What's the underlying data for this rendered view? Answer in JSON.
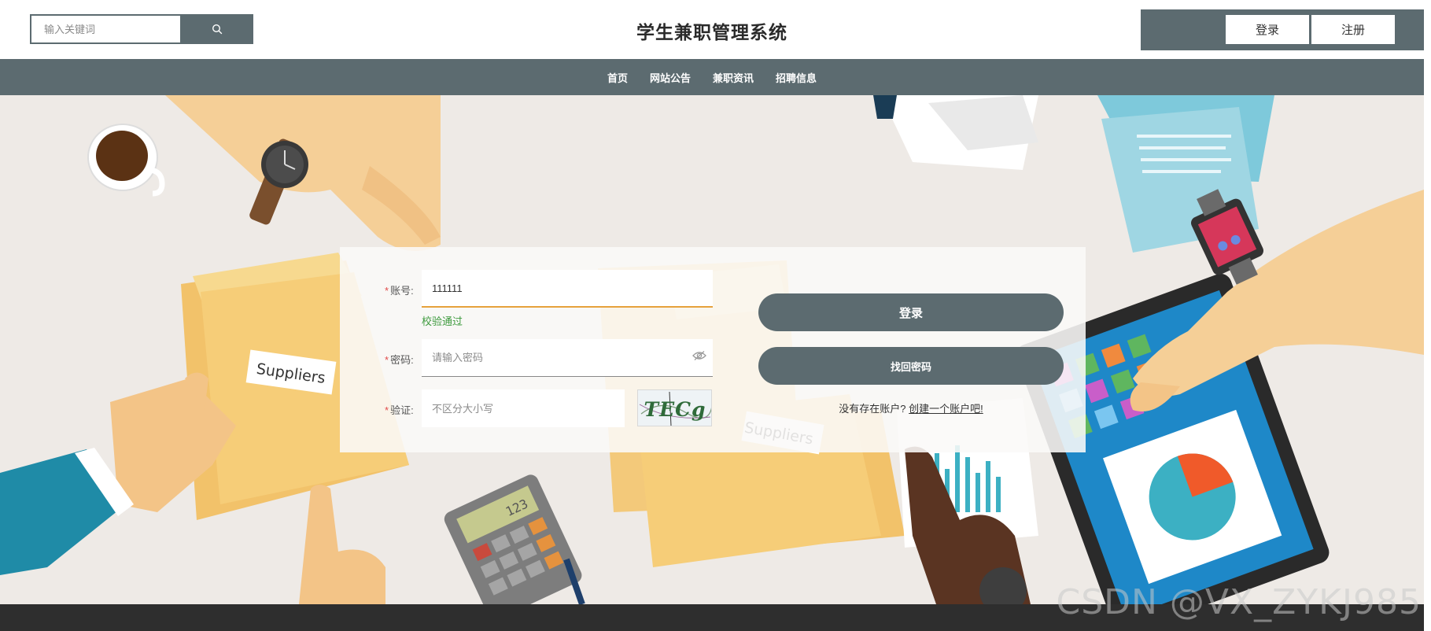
{
  "header": {
    "search_placeholder": "输入关键词",
    "site_title": "学生兼职管理系统",
    "login_label": "登录",
    "register_label": "注册"
  },
  "nav": {
    "items": [
      {
        "label": "首页"
      },
      {
        "label": "网站公告"
      },
      {
        "label": "兼职资讯"
      },
      {
        "label": "招聘信息"
      }
    ]
  },
  "hero": {
    "folder_label": "Suppliers",
    "calculator_display": "123"
  },
  "login_form": {
    "required_mark": "*",
    "account_label": "账号:",
    "account_value": "111111",
    "validation_message": "校验通过",
    "password_label": "密码:",
    "password_placeholder": "请输入密码",
    "captcha_label": "验证:",
    "captcha_placeholder": "不区分大小写",
    "captcha_text": "TECg",
    "login_button": "登录",
    "forgot_button": "找回密码",
    "no_account_text": "没有存在账户?",
    "create_account_link": "创建一个账户吧!"
  },
  "watermark": "CSDN @VX_ZYKJ985",
  "colors": {
    "primary": "#5c6b70",
    "valid_text": "#3d9a3d",
    "focus_underline": "#e6a23c",
    "required": "#e14b4b",
    "footer": "#2e2e2e"
  }
}
